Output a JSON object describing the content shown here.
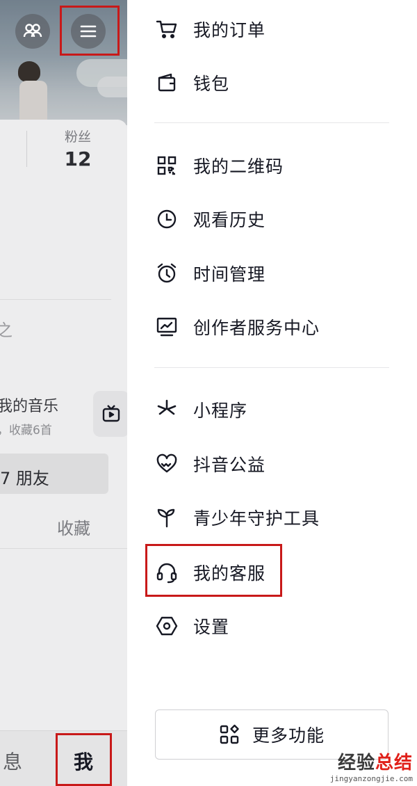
{
  "profile": {
    "fans_label": "粉丝",
    "fans_count": "12",
    "partial_text": "之",
    "music_title": "我的音乐",
    "music_subtitle": "，收藏6首",
    "friends_text": "7 朋友",
    "tab_collect": "收藏"
  },
  "bottom_nav": {
    "message": "息",
    "me": "我"
  },
  "drawer": {
    "items": [
      {
        "label": "我的订单",
        "icon": "cart-icon"
      },
      {
        "label": "钱包",
        "icon": "wallet-icon"
      },
      {
        "label": "我的二维码",
        "icon": "qr-code-icon"
      },
      {
        "label": "观看历史",
        "icon": "clock-icon"
      },
      {
        "label": "时间管理",
        "icon": "alarm-clock-icon"
      },
      {
        "label": "创作者服务中心",
        "icon": "chart-monitor-icon"
      },
      {
        "label": "小程序",
        "icon": "mini-program-icon"
      },
      {
        "label": "抖音公益",
        "icon": "charity-heart-icon"
      },
      {
        "label": "青少年守护工具",
        "icon": "sprout-icon"
      },
      {
        "label": "我的客服",
        "icon": "headset-icon"
      },
      {
        "label": "设置",
        "icon": "settings-hex-icon"
      }
    ],
    "more_button": "更多功能"
  },
  "watermark": {
    "cn_plain": "经验",
    "cn_accent": "总结",
    "en": "jingyanzongjie.com"
  },
  "colors": {
    "highlight": "#c81919",
    "text": "#161823",
    "dim_overlay": "#e8e8e9"
  }
}
